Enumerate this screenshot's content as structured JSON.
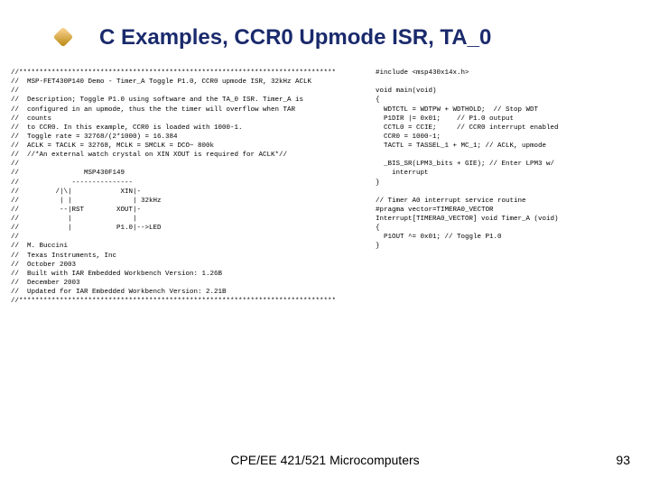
{
  "title": "C Examples, CCR0 Upmode ISR, TA_0",
  "left_code": "//******************************************************************************\n//  MSP-FET430P140 Demo - Timer_A Toggle P1.0, CCR0 upmode ISR, 32kHz ACLK\n//\n//  Description; Toggle P1.0 using software and the TA_0 ISR. Timer_A is\n//  configured in an upmode, thus the the timer will overflow when TAR\n//  counts\n//  to CCR0. In this example, CCR0 is loaded with 1000-1.\n//  Toggle rate = 32768/(2*1000) = 16.384\n//  ACLK = TACLK = 32768, MCLK = SMCLK = DCO~ 800k\n//  //*An external watch crystal on XIN XOUT is required for ACLK*//\n//\n//                MSP430F149\n//             ---------------\n//         /|\\|            XIN|-\n//          | |               | 32kHz\n//          --|RST        XOUT|-\n//            |               |\n//            |           P1.0|-->LED\n//\n//  M. Buccini\n//  Texas Instruments, Inc\n//  October 2003\n//  Built with IAR Embedded Workbench Version: 1.26B\n//  December 2003\n//  Updated for IAR Embedded Workbench Version: 2.21B\n//******************************************************************************",
  "right_code": "#include <msp430x14x.h>\n\nvoid main(void)\n{\n  WDTCTL = WDTPW + WDTHOLD;  // Stop WDT\n  P1DIR |= 0x01;    // P1.0 output\n  CCTL0 = CCIE;     // CCR0 interrupt enabled\n  CCR0 = 1000-1;\n  TACTL = TASSEL_1 + MC_1; // ACLK, upmode\n\n  _BIS_SR(LPM3_bits + GIE); // Enter LPM3 w/\n    interrupt\n}\n\n// Timer A0 interrupt service routine\n#pragma vector=TIMERA0_VECTOR\nInterrupt[TIMERA0_VECTOR] void Timer_A (void)\n{\n  P1OUT ^= 0x01; // Toggle P1.0\n}",
  "footer_center": "CPE/EE 421/521 Microcomputers",
  "footer_right": "93"
}
